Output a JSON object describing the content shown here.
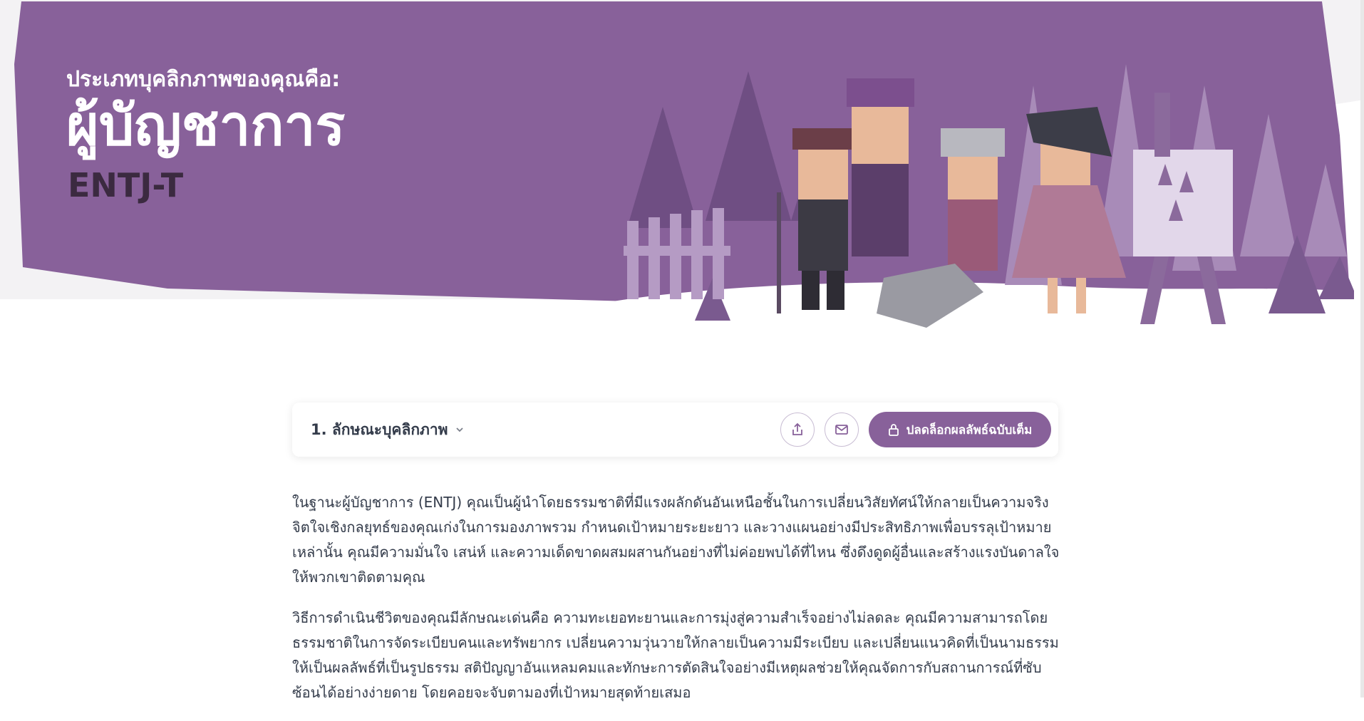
{
  "hero": {
    "subtitle": "ประเภทบุคลิกภาพของคุณคือ:",
    "title": "ผู้บัญชาการ",
    "code": "ENTJ-T",
    "illustration": "group-of-characters-illustration"
  },
  "section_bar": {
    "section_label": "1. ลักษณะบุคลิกภาพ",
    "share_icon": "share-icon",
    "email_icon": "envelope-icon",
    "unlock_label": "ปลดล็อกผลลัพธ์ฉบับเต็ม",
    "lock_icon": "lock-icon"
  },
  "content": {
    "paragraphs": [
      "ในฐานะผู้บัญชาการ (ENTJ) คุณเป็นผู้นำโดยธรรมชาติที่มีแรงผลักดันอันเหนือชั้นในการเปลี่ยนวิสัยทัศน์ให้กลายเป็นความจริง จิตใจเชิงกลยุทธ์ของคุณเก่งในการมองภาพรวม กำหนดเป้าหมายระยะยาว และวางแผนอย่างมีประสิทธิภาพเพื่อบรรลุเป้าหมายเหล่านั้น คุณมีความมั่นใจ เสน่ห์ และความเด็ดขาดผสมผสานกันอย่างที่ไม่ค่อยพบได้ที่ไหน ซึ่งดึงดูดผู้อื่นและสร้างแรงบันดาลใจให้พวกเขาติดตามคุณ",
      "วิธีการดำเนินชีวิตของคุณมีลักษณะเด่นคือ ความทะเยอทะยานและการมุ่งสู่ความสำเร็จอย่างไม่ลดละ คุณมีความสามารถโดยธรรมชาติในการจัดระเบียบคนและทรัพยากร เปลี่ยนความวุ่นวายให้กลายเป็นความมีระเบียบ และเปลี่ยนแนวคิดที่เป็นนามธรรมให้เป็นผลลัพธ์ที่เป็นรูปธรรม สติปัญญาอันแหลมคมและทักษะการตัดสินใจอย่างมีเหตุผลช่วยให้คุณจัดการกับสถานการณ์ที่ซับซ้อนได้อย่างง่ายดาย โดยคอยจะจับตามองที่เป้าหมายสุดท้ายเสมอ"
    ]
  },
  "colors": {
    "brand_purple": "#88619a",
    "code_dark": "#3b2a40",
    "text": "#343c4b"
  }
}
